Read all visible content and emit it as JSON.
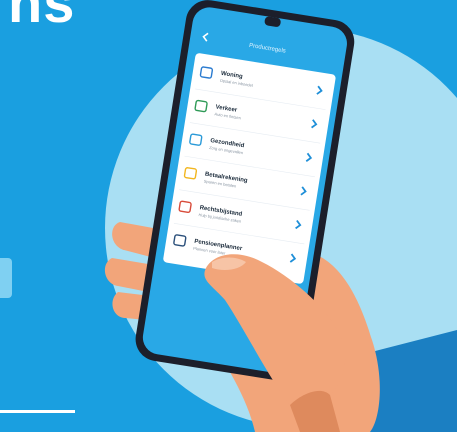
{
  "corner_text": "ns",
  "colors": {
    "background": "#1a9fe0",
    "circle": "#a9dff3",
    "phone_body": "#1c1f2b",
    "screen": "#29a8e6",
    "card": "#ffffff",
    "chevron": "#1f8fd8",
    "skin": "#f2a57a",
    "skin_shadow": "#de8a5d",
    "sleeve": "#1b7fc2"
  },
  "app": {
    "back_icon": "chevron-left-icon",
    "title": "Productregels",
    "items": [
      {
        "icon": "house-icon",
        "title": "Woning",
        "subtitle": "Opstal en inboedel"
      },
      {
        "icon": "car-icon",
        "title": "Verkeer",
        "subtitle": "Auto en fietsen"
      },
      {
        "icon": "id-card-icon",
        "title": "Gezondheid",
        "subtitle": "Zorg en ongevallen"
      },
      {
        "icon": "wallet-icon",
        "title": "Betaalrekening",
        "subtitle": "Sparen en betalen"
      },
      {
        "icon": "umbrella-icon",
        "title": "Rechtsbijstand",
        "subtitle": "Hulp bij juridische zaken"
      },
      {
        "icon": "clock-icon",
        "title": "Pensioenplanner",
        "subtitle": "Plannen voor later"
      }
    ]
  }
}
